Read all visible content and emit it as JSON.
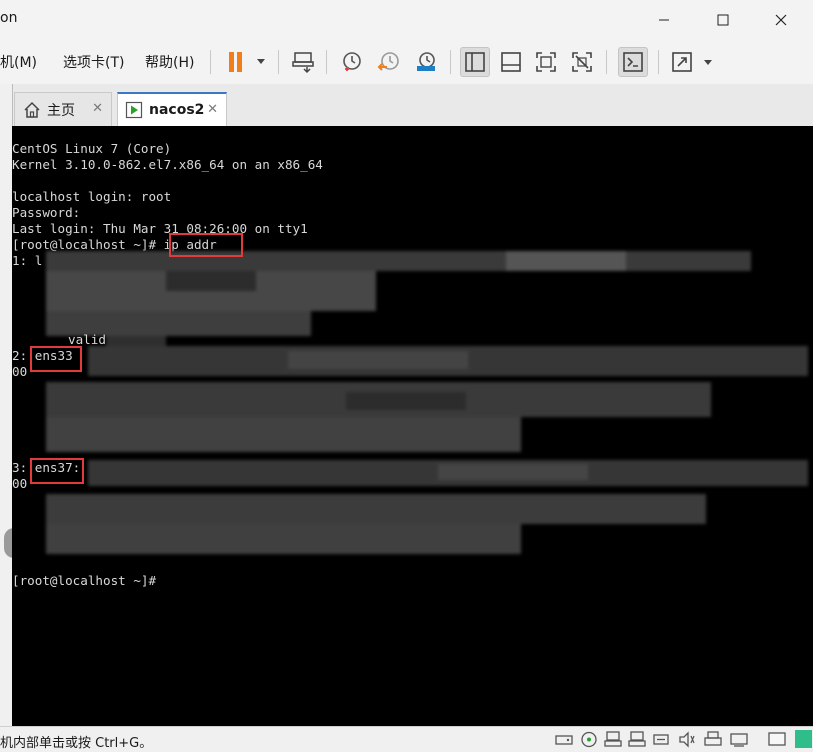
{
  "window": {
    "title_fragment": "on"
  },
  "menu": [
    {
      "label": "机(M)"
    },
    {
      "label": "选项卡(T)"
    },
    {
      "label": "帮助(H)"
    }
  ],
  "tabs": [
    {
      "label": "主页"
    },
    {
      "label": "nacos2"
    }
  ],
  "console": {
    "lines": [
      "CentOS Linux 7 (Core)",
      "Kernel 3.10.0-862.el7.x86_64 on an x86_64",
      "",
      "localhost login: root",
      "Password:",
      "Last login: Thu Mar 31 08:26:00 on tty1",
      "[root@localhost ~]# ip addr",
      "1: l",
      "valid",
      "2: ens33",
      "00",
      "3: ens37:",
      "00",
      "[root@localhost ~]#"
    ]
  },
  "status": {
    "hint": "机内部单击或按 Ctrl+G。"
  },
  "colors": {
    "highlight_box": "#e23b3b",
    "pause_accent": "#f07f1a",
    "terminal_bg": "#000000",
    "terminal_fg": "#d8d8d8"
  }
}
